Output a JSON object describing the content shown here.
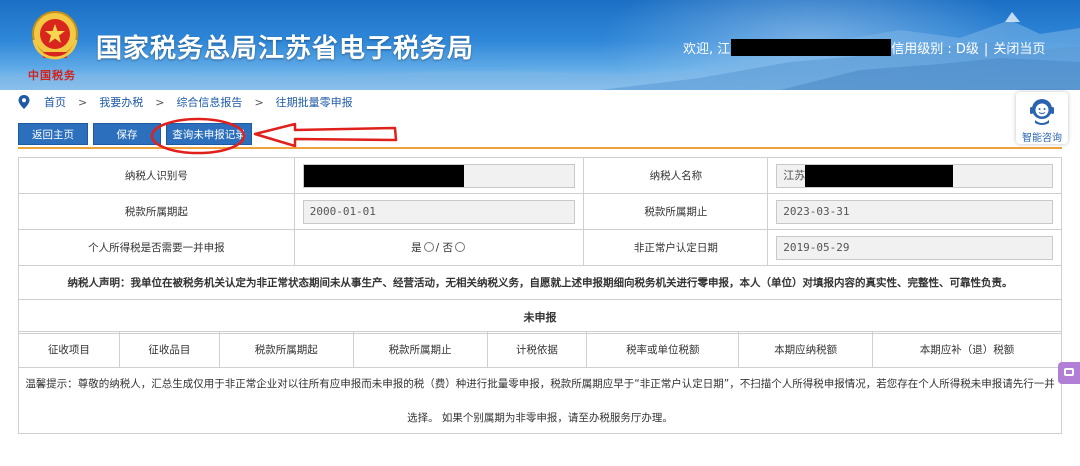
{
  "header": {
    "emblem_caption": "中国税务",
    "site_title": "国家税务总局江苏省电子税务局",
    "welcome_prefix": "欢迎, 江苏",
    "credit_level": "信用级别 : D级",
    "separator": "|",
    "close_page": "关闭当页"
  },
  "breadcrumb": {
    "items": [
      "首页",
      "我要办税",
      "综合信息报告",
      "往期批量零申报"
    ],
    "arrow": ">"
  },
  "consult": {
    "label": "智能咨询"
  },
  "toolbar": {
    "back_home": "返回主页",
    "save": "保存",
    "query_unfiled": "查询未申报记录"
  },
  "form": {
    "taxpayer_id_label": "纳税人识别号",
    "taxpayer_id_value": "",
    "taxpayer_name_label": "纳税人名称",
    "taxpayer_name_value": "江苏",
    "period_start_label": "税款所属期起",
    "period_start_value": "2000-01-01",
    "period_end_label": "税款所属期止",
    "period_end_value": "2023-03-31",
    "iit_label": "个人所得税是否需要一并申报",
    "iit_yes": "是",
    "iit_slash": "/ 否",
    "abnormal_date_label": "非正常户认定日期",
    "abnormal_date_value": "2019-05-29",
    "statement": "纳税人声明：我单位在被税务机关认定为非正常状态期间未从事生产、经营活动，无相关纳税义务，自愿就上述申报期细向税务机关进行零申报，本人（单位）对填报内容的真实性、完整性、可靠性负责。",
    "section_title": "未申报"
  },
  "table": {
    "columns": [
      "征收项目",
      "征收品目",
      "税款所属期起",
      "税款所属期止",
      "计税依据",
      "税率或单位税额",
      "本期应纳税额",
      "本期应补（退）税额"
    ]
  },
  "tip": {
    "line1": "温馨提示：尊敬的纳税人，汇总生成仅用于非正常企业对以往所有应申报而未申报的税（费）种进行批量零申报，税款所属期应早于“非正常户认定日期”，不扫描个人所得税申报情况，若您存在个人所得税未申报请先行一并",
    "line2": "选择。 如果个别属期为非零申报，请至办税服务厅办理。"
  },
  "colors": {
    "banner_blue": "#2f87d8",
    "button_blue": "#2c6fbd",
    "accent_orange": "#f0a23a",
    "annotation_red": "#e0201b"
  }
}
